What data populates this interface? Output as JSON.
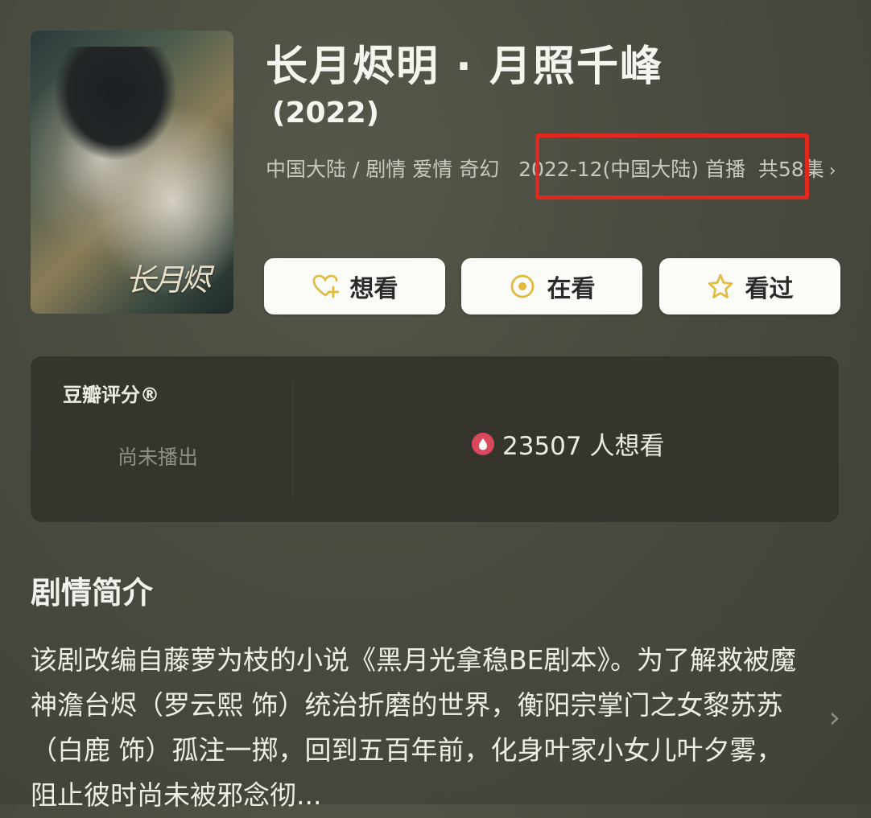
{
  "header": {
    "title": "长月烬明 · 月照千峰",
    "year": "(2022)",
    "meta_line": "中国大陆 / 剧情 爱情 奇幻",
    "premiere": "2022-12(中国大陆) 首播",
    "episodes": "共58集",
    "episodes_chevron": "›"
  },
  "poster": {
    "calligraphy": "长月烬"
  },
  "buttons": [
    {
      "label": "想看",
      "icon": "heart-plus-icon"
    },
    {
      "label": "在看",
      "icon": "target-icon"
    },
    {
      "label": "看过",
      "icon": "star-icon"
    }
  ],
  "rating": {
    "label": "豆瓣评分®",
    "status": "尚未播出",
    "wish_count": "23507 人想看"
  },
  "synopsis": {
    "heading": "剧情简介",
    "text": "该剧改编自藤萝为枝的小说《黑月光拿稳BE剧本》。为了解救被魔神澹台烬（罗云熙 饰）统治折磨的世界，衡阳宗掌门之女黎苏苏（白鹿 饰）孤注一掷，回到五百年前，化身叶家小女儿叶夕雾，阻止彼时尚未被邪念彻...",
    "more_chevron": "›"
  },
  "colors": {
    "highlight": "#e2271f",
    "accent_icon": "#e2b93b",
    "flame": "#d9485b"
  }
}
